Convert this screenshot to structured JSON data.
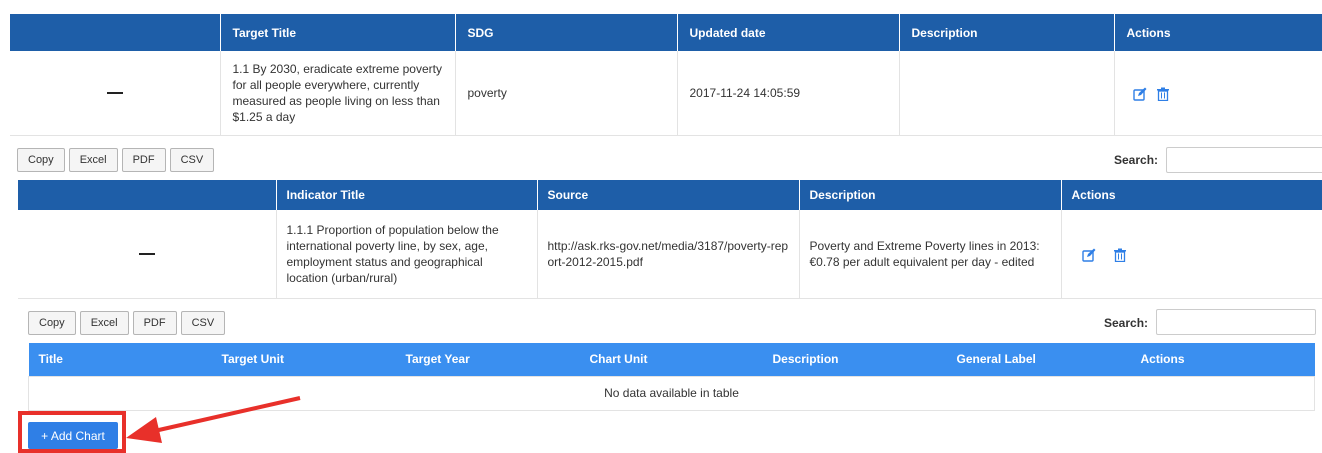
{
  "target_table": {
    "headers": [
      "",
      "Target Title",
      "SDG",
      "Updated date",
      "Description",
      "Actions"
    ],
    "row": {
      "title": "1.1 By 2030, eradicate extreme poverty for all people everywhere, currently measured as people living on less than $1.25 a day",
      "sdg": "poverty",
      "updated": "2017-11-24 14:05:59",
      "description": ""
    }
  },
  "toolbar1": {
    "copy": "Copy",
    "excel": "Excel",
    "pdf": "PDF",
    "csv": "CSV",
    "search_label": "Search:",
    "search_value": ""
  },
  "indicator_table": {
    "headers": [
      "",
      "Indicator Title",
      "Source",
      "Description",
      "Actions"
    ],
    "row": {
      "title": "1.1.1 Proportion of population below the international poverty line, by sex, age, employment status and geographical location (urban/rural)",
      "source": "http://ask.rks-gov.net/media/3187/poverty-report-2012-2015.pdf",
      "description": "Poverty and Extreme Poverty lines in 2013: €0.78 per adult equivalent per day - edited"
    }
  },
  "toolbar2": {
    "copy": "Copy",
    "excel": "Excel",
    "pdf": "PDF",
    "csv": "CSV",
    "search_label": "Search:",
    "search_value": ""
  },
  "chart_table": {
    "headers": [
      "Title",
      "Target Unit",
      "Target Year",
      "Chart Unit",
      "Description",
      "General Label",
      "Actions"
    ],
    "empty_message": "No data available in table"
  },
  "add_chart_label": "+ Add Chart",
  "icons": {
    "edit": "edit-icon",
    "delete": "trash-icon"
  },
  "colors": {
    "header_dark": "#1e5ea8",
    "header_light": "#3a8ff0",
    "button": "#2f7fe6",
    "highlight": "#e8302a"
  }
}
